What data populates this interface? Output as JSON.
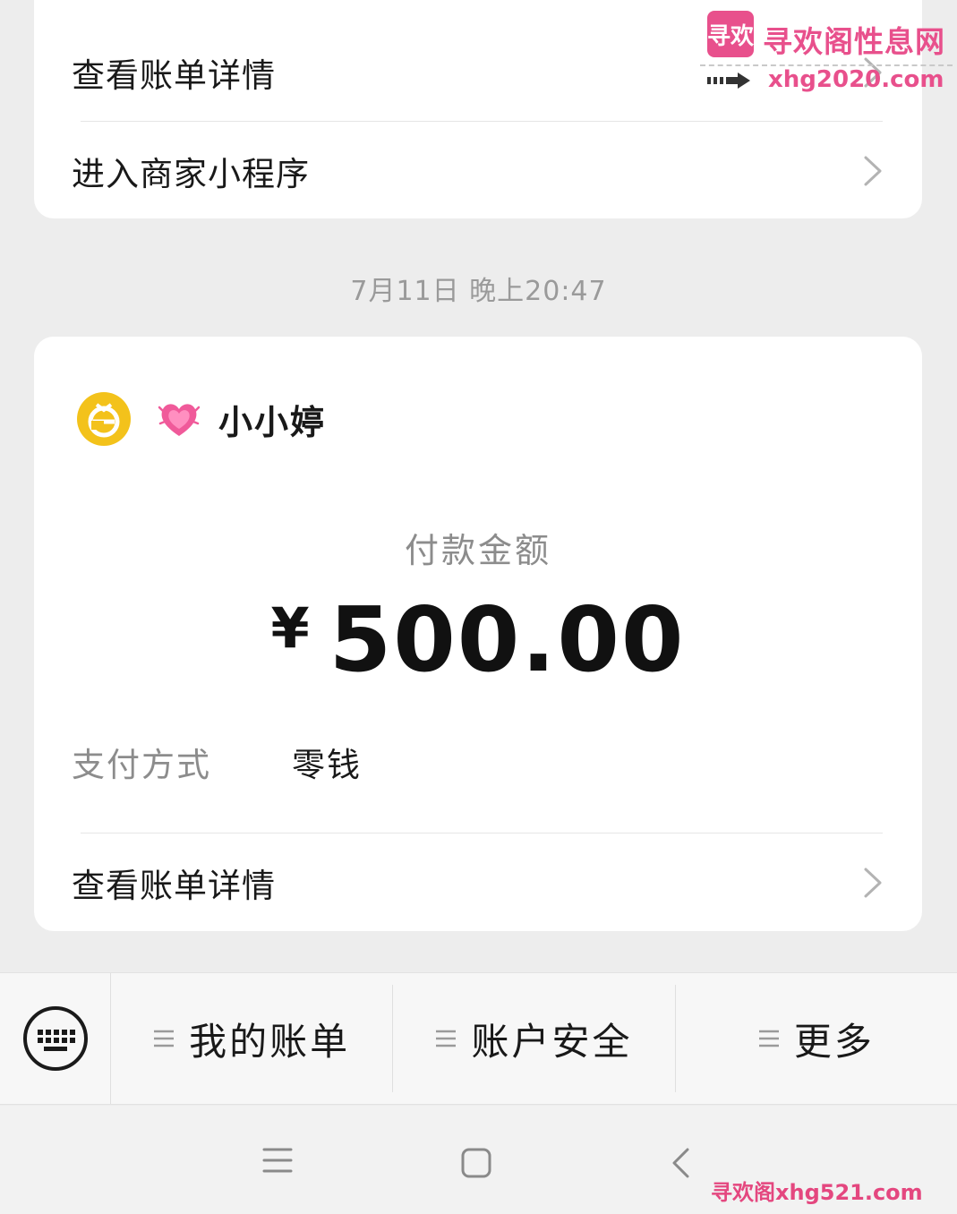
{
  "top_card": {
    "rows": [
      {
        "label": "查看账单详情"
      },
      {
        "label": "进入商家小程序"
      }
    ]
  },
  "timestamp": "7月11日 晚上20:47",
  "payment_card": {
    "payee_name": "小小婷",
    "amount_label": "付款金额",
    "currency": "¥",
    "amount": "500.00",
    "pay_method_label": "支付方式",
    "pay_method_value": "零钱",
    "detail_row_label": "查看账单详情"
  },
  "bottom_menu": {
    "items": [
      {
        "label": "我的账单"
      },
      {
        "label": "账户安全"
      },
      {
        "label": "更多"
      }
    ]
  },
  "watermark": {
    "logo_text": "寻欢",
    "site_name": "寻欢阁性息网",
    "site_url": "xhg2020.com",
    "bottom_text": "寻欢阁xhg521.com"
  },
  "icons": {
    "chevron": "chevron-right-icon",
    "keyboard": "keyboard-icon",
    "menu_glyph": "menu-lines-icon",
    "heart": "growing-heart-emoji",
    "avatar": "yellow-logo-avatar"
  },
  "colors": {
    "page_bg": "#ededed",
    "card_bg": "#ffffff",
    "watermark": "#e8508c",
    "avatar": "#f3c21b"
  }
}
